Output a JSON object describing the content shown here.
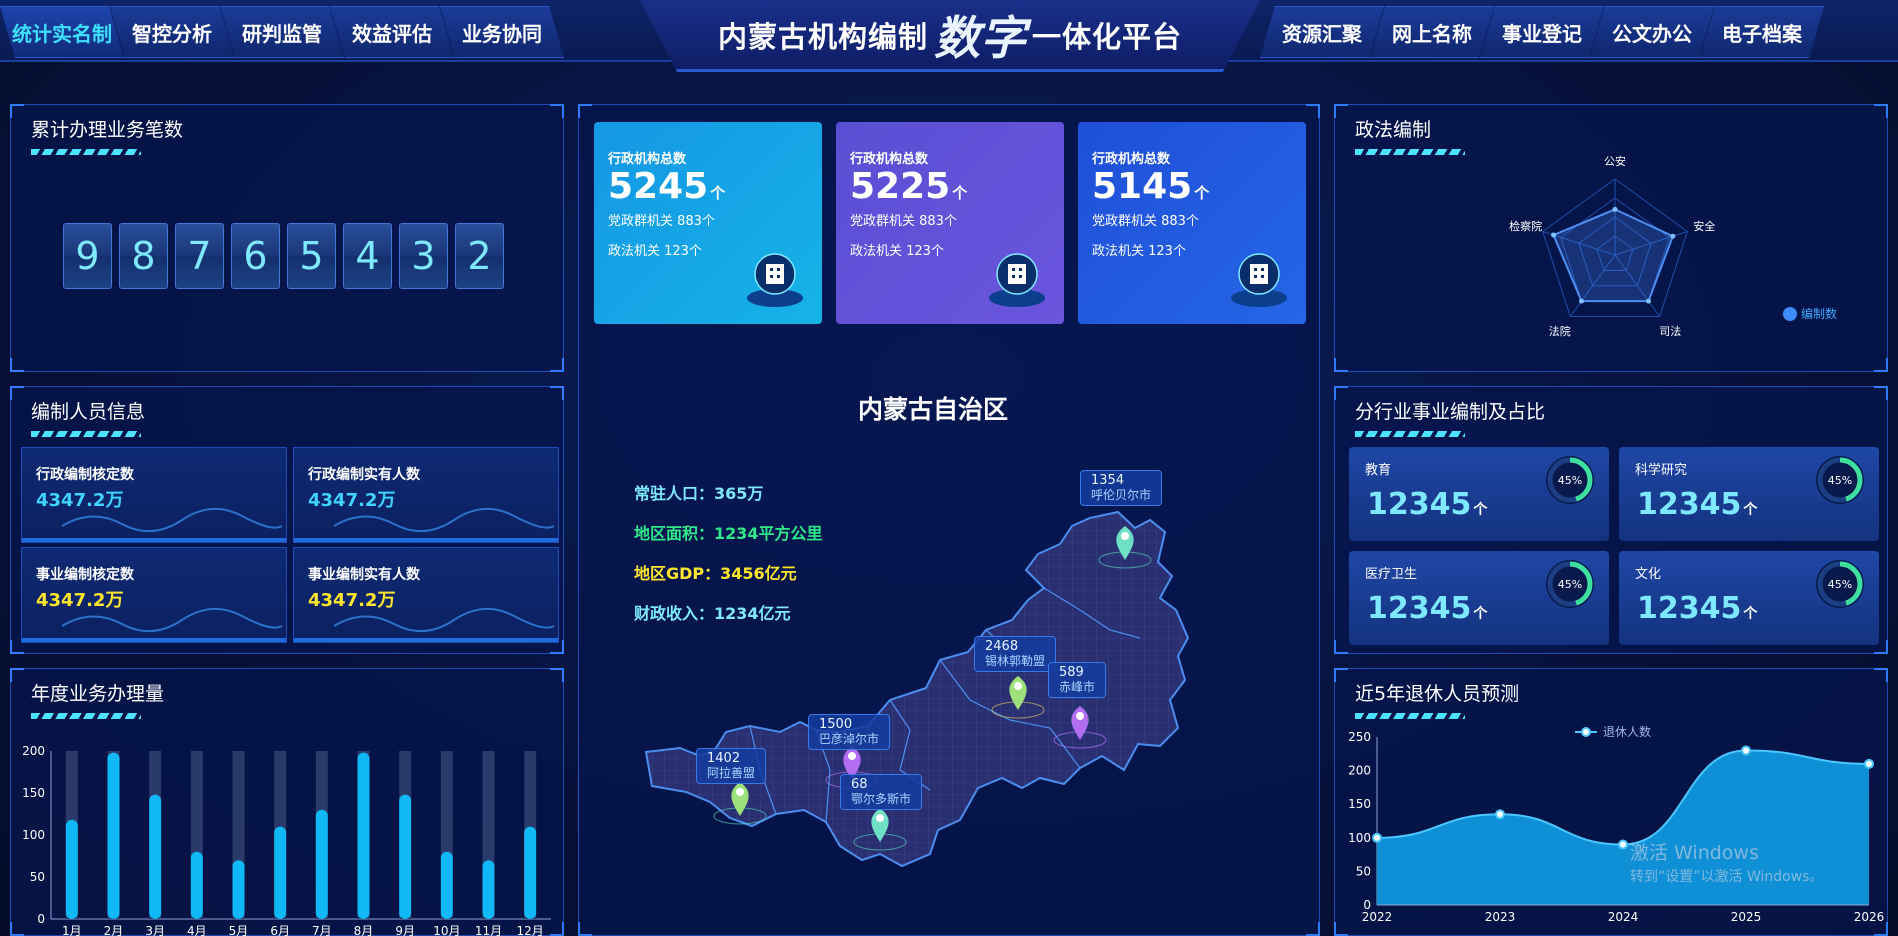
{
  "header": {
    "title_part1": "内蒙古机构编制",
    "title_part2": "数字",
    "title_part3": "一体化平台",
    "nav_left": [
      "统计实名制",
      "智控分析",
      "研判监管",
      "效益评估",
      "业务协同"
    ],
    "nav_right": [
      "资源汇聚",
      "网上名称",
      "事业登记",
      "公文办公",
      "电子档案"
    ],
    "active": "统计实名制"
  },
  "counter": {
    "title": "累计办理业务笔数",
    "digits": [
      "9",
      "8",
      "7",
      "6",
      "5",
      "4",
      "3",
      "2"
    ]
  },
  "staffing": {
    "title": "编制人员信息",
    "cards": [
      {
        "label": "行政编制核定数",
        "value": "4347.2万",
        "color": "#3fd3ff"
      },
      {
        "label": "行政编制实有人数",
        "value": "4347.2万",
        "color": "#3fd3ff"
      },
      {
        "label": "事业编制核定数",
        "value": "4347.2万",
        "color": "#ffe62e"
      },
      {
        "label": "事业编制实有人数",
        "value": "4347.2万",
        "color": "#ffe62e"
      }
    ]
  },
  "stats": [
    {
      "label": "行政机构总数",
      "value": "5245",
      "unit": "个",
      "line2": "党政群机关 883个",
      "line3": "政法机关 123个",
      "gradient": "#1597e5,#16b3e6"
    },
    {
      "label": "行政机构总数",
      "value": "5225",
      "unit": "个",
      "line2": "党政群机关 883个",
      "line3": "政法机关 123个",
      "gradient": "#5a4fd4,#6a55dd"
    },
    {
      "label": "行政机构总数",
      "value": "5145",
      "unit": "个",
      "line2": "党政群机关 883个",
      "line3": "政法机关 123个",
      "gradient": "#1f4fd8,#2566e6"
    }
  ],
  "map": {
    "region_title": "内蒙古自治区",
    "info": [
      {
        "label": "常驻人口：365万",
        "color": "#7ee8ff"
      },
      {
        "label": "地区面积：1234平方公里",
        "color": "#2ee88a"
      },
      {
        "label": "地区GDP：3456亿元",
        "color": "#ffe62e"
      },
      {
        "label": "财政收入：1234亿元",
        "color": "#7ee8ff"
      }
    ],
    "pins": [
      {
        "value": "1354",
        "name": "呼伦贝尔市"
      },
      {
        "value": "2468",
        "name": "锡林郭勒盟"
      },
      {
        "value": "589",
        "name": "赤峰市"
      },
      {
        "value": "1500",
        "name": "巴彦淖尔市"
      },
      {
        "value": "1402",
        "name": "阿拉善盟"
      },
      {
        "value": "68",
        "name": "鄂尔多斯市"
      }
    ]
  },
  "legal": {
    "title": "政法编制",
    "axes": [
      "公安",
      "安全",
      "司法",
      "法院",
      "检察院"
    ],
    "legend": "编制数",
    "values": [
      0.6,
      0.8,
      0.75,
      0.75,
      0.85
    ]
  },
  "industry": {
    "title": "分行业事业编制及占比",
    "cards": [
      {
        "label": "教育",
        "value": "12345",
        "unit": "个",
        "pct": "45%",
        "pct_value": 45
      },
      {
        "label": "科学研究",
        "value": "12345",
        "unit": "个",
        "pct": "45%",
        "pct_value": 45
      },
      {
        "label": "医疗卫生",
        "value": "12345",
        "unit": "个",
        "pct": "45%",
        "pct_value": 45
      },
      {
        "label": "文化",
        "value": "12345",
        "unit": "个",
        "pct": "45%",
        "pct_value": 45
      }
    ]
  },
  "yearly": {
    "title": "年度业务办理量"
  },
  "retire": {
    "title": "近5年退休人员预测"
  },
  "watermark": {
    "line1": "激活 Windows",
    "line2": "转到“设置”以激活 Windows。"
  },
  "chart_data": [
    {
      "type": "bar",
      "categories": [
        "1月",
        "2月",
        "3月",
        "4月",
        "5月",
        "6月",
        "7月",
        "8月",
        "9月",
        "10月",
        "11月",
        "12月"
      ],
      "values": [
        118,
        198,
        148,
        80,
        70,
        110,
        130,
        198,
        148,
        80,
        70,
        110
      ],
      "ylim": [
        0,
        200
      ],
      "yticks": [
        0,
        50,
        100,
        150,
        200
      ]
    },
    {
      "type": "area",
      "x": [
        "2022",
        "2023",
        "2024",
        "2025",
        "2026"
      ],
      "series": [
        {
          "name": "退休人数",
          "values": [
            100,
            135,
            90,
            230,
            210
          ]
        }
      ],
      "ylim": [
        0,
        250
      ],
      "yticks": [
        0,
        50,
        100,
        150,
        200,
        250
      ]
    }
  ]
}
